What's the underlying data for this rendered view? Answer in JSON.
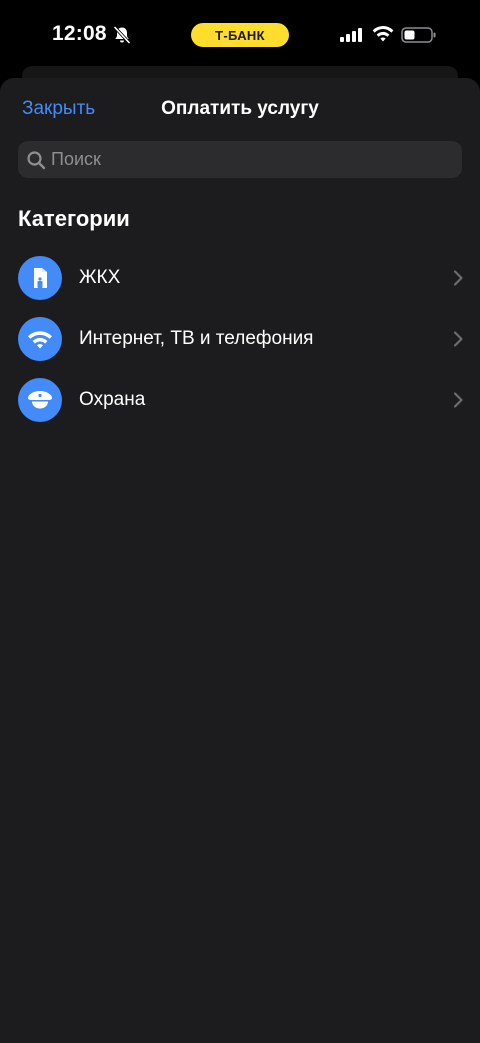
{
  "status_bar": {
    "time": "12:08",
    "carrier": "Т-БАНК"
  },
  "header": {
    "close_label": "Закрыть",
    "title": "Оплатить услугу"
  },
  "search": {
    "placeholder": "Поиск",
    "value": ""
  },
  "categories": {
    "heading": "Категории",
    "items": [
      {
        "label": "ЖКХ",
        "icon": "building-icon"
      },
      {
        "label": "Интернет, ТВ и телефония",
        "icon": "wifi-icon"
      },
      {
        "label": "Охрана",
        "icon": "guard-cap-icon"
      }
    ]
  },
  "colors": {
    "accent": "#428bf9",
    "brand_yellow": "#ffdd2d",
    "sheet_background": "#1c1c1e",
    "search_background": "#2c2c2e"
  }
}
